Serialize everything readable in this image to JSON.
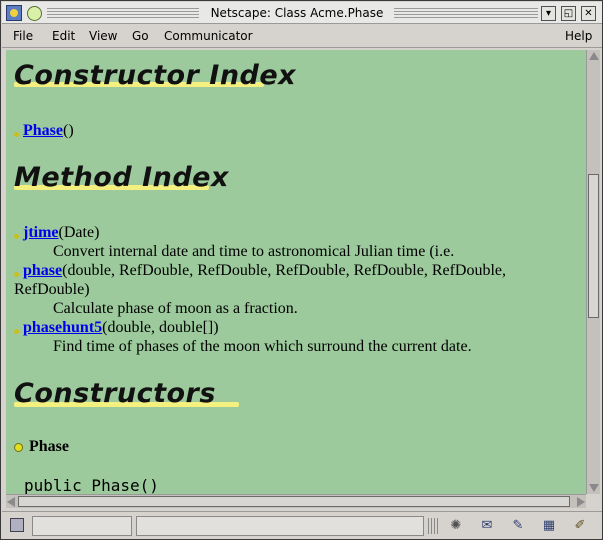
{
  "window": {
    "title": "Netscape: Class Acme.Phase",
    "buttons": [
      "minimize-icon",
      "maximize-icon",
      "close-icon"
    ]
  },
  "menu": {
    "file": "File",
    "edit": "Edit",
    "view": "View",
    "go": "Go",
    "communicator": "Communicator",
    "help": "Help"
  },
  "content": {
    "constructor_index": {
      "heading": "Constructor Index",
      "items": [
        {
          "name": "Phase",
          "signature": "()"
        }
      ]
    },
    "method_index": {
      "heading": "Method Index",
      "items": [
        {
          "name": "jtime",
          "signature": "(Date)",
          "description": "Convert internal date and time to astronomical Julian time (i.e."
        },
        {
          "name": "phase",
          "signature": "(double, RefDouble, RefDouble, RefDouble, RefDouble, RefDouble,",
          "signature_cont": "RefDouble)",
          "description": "Calculate phase of moon as a fraction."
        },
        {
          "name": "phasehunt5",
          "signature": "(double, double[])",
          "description": "Find time of phases of the moon which surround the current date."
        }
      ]
    },
    "constructors": {
      "heading": "Constructors",
      "item_name": "Phase",
      "code": "public Phase()"
    }
  },
  "colors": {
    "background": "#9cca9c",
    "link": "#0000ee",
    "heading_highlight": "#f4f080",
    "chrome": "#d6d3ce"
  },
  "status_icons": [
    "security-lock-icon",
    "navigator-icon",
    "mail-icon",
    "discussion-icon",
    "composer-icon",
    "edit-icon"
  ]
}
